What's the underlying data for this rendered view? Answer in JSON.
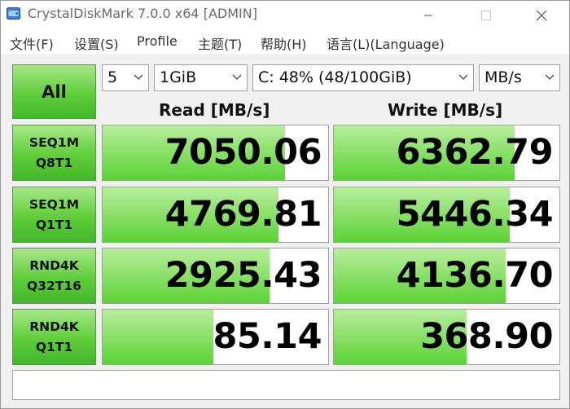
{
  "window": {
    "title": "CrystalDiskMark 7.0.0 x64 [ADMIN]"
  },
  "menu": {
    "items": [
      "文件(F)",
      "设置(S)",
      "Profile",
      "主题(T)",
      "帮助(H)",
      "语言(L)(Language)"
    ]
  },
  "controls": {
    "all_label": "All",
    "count": "5",
    "size": "1GiB",
    "drive": "C: 48% (48/100GiB)",
    "unit": "MB/s"
  },
  "headers": {
    "read": "Read [MB/s]",
    "write": "Write [MB/s]"
  },
  "tests": [
    {
      "line1": "SEQ1M",
      "line2": "Q8T1",
      "read": "7050.06",
      "write": "6362.79",
      "read_fill": 0.81,
      "write_fill": 0.8
    },
    {
      "line1": "SEQ1M",
      "line2": "Q1T1",
      "read": "4769.81",
      "write": "5446.34",
      "read_fill": 0.78,
      "write_fill": 0.78
    },
    {
      "line1": "RND4K",
      "line2": "Q32T16",
      "read": "2925.43",
      "write": "4136.70",
      "read_fill": 0.74,
      "write_fill": 0.76
    },
    {
      "line1": "RND4K",
      "line2": "Q1T1",
      "read": "85.14",
      "write": "368.90",
      "read_fill": 0.49,
      "write_fill": 0.59
    }
  ],
  "comment": "",
  "colors": {
    "accent_green": "#5cd236",
    "bar_light": "#b8ee9c"
  }
}
